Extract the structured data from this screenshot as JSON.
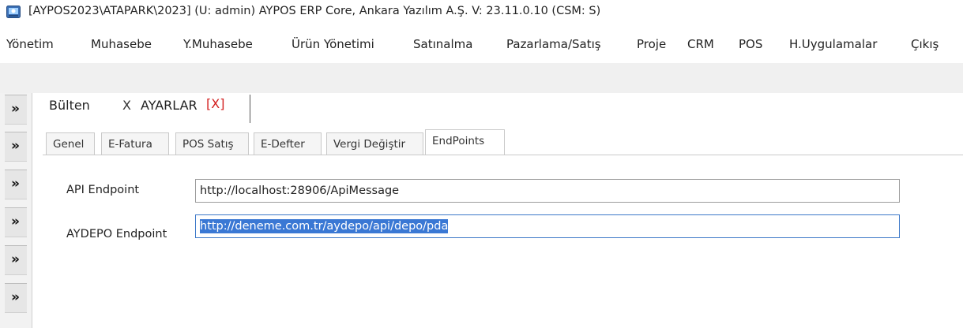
{
  "window": {
    "title": "[AYPOS2023\\ATAPARK\\2023] (U: admin) AYPOS ERP Core, Ankara Yazılım A.Ş. V: 23.11.0.10 (CSM: S)",
    "icon": "app-icon"
  },
  "menu": {
    "items": [
      "Yönetim",
      "Muhasebe",
      "Y.Muhasebe",
      "Ürün Yönetimi",
      "Satınalma",
      "Pazarlama/Satış",
      "Proje",
      "CRM",
      "POS",
      "H.Uygulamalar",
      "Çıkış"
    ]
  },
  "dock": {
    "glyph": "»",
    "buttons": 6
  },
  "doc_tabs": {
    "items": [
      {
        "label": "Bülten",
        "close": "X"
      },
      {
        "label": "AYARLAR",
        "close": "[X]"
      }
    ],
    "close_color": "#d32020"
  },
  "settings_tabs": {
    "items": [
      "Genel",
      "E-Fatura",
      "POS Satış",
      "E-Defter",
      "Vergi Değiştir",
      "EndPoints"
    ],
    "active": "EndPoints"
  },
  "form": {
    "api_label": "API Endpoint",
    "api_value": "http://localhost:28906/ApiMessage",
    "aydepo_label": "AYDEPO Endpoint",
    "aydepo_value": "http://deneme.com.tr/aydepo/api/depo/pda"
  },
  "colors": {
    "selection": "#3a78d4",
    "focus_border": "#3c78c8"
  }
}
